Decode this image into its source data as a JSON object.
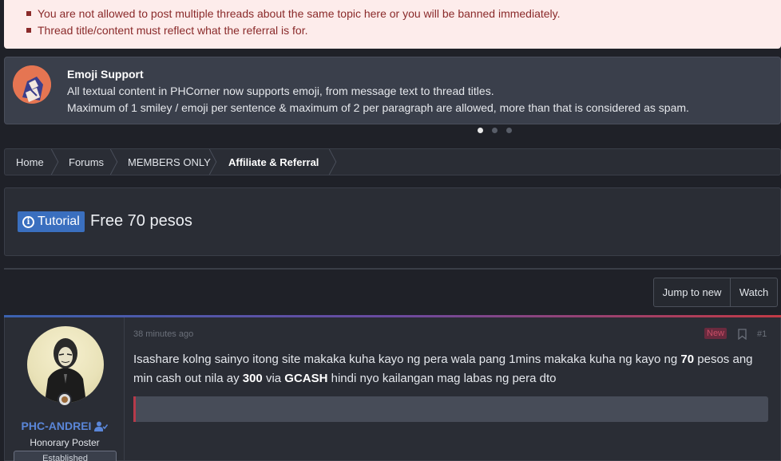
{
  "notices": {
    "rules": [
      "You are not allowed to post multiple threads about the same topic here or you will be banned immediately.",
      "Thread title/content must reflect what the referral is for."
    ],
    "emoji": {
      "title": "Emoji Support",
      "line1": "All textual content in PHCorner now supports emoji, from message text to thread titles.",
      "line2": "Maximum of 1 smiley / emoji per sentence & maximum of 2 per paragraph are allowed, more than that is considered as spam."
    },
    "carousel_active_index": 1,
    "carousel_count": 3
  },
  "breadcrumb": [
    "Home",
    "Forums",
    "MEMBERS ONLY",
    "Affiliate & Referral"
  ],
  "thread": {
    "prefix": "Tutorial",
    "title": "Free 70 pesos"
  },
  "actions": {
    "jump_to_new": "Jump to new",
    "watch": "Watch"
  },
  "post": {
    "time": "38 minutes ago",
    "new_label": "New",
    "number": "#1",
    "body_parts": {
      "p1": "Isashare kolng sainyo itong site makaka kuha kayo ng pera wala pang 1mins makaka kuha ng kayo ng ",
      "b1": "70",
      "p2": " pesos ang min cash out nila ay ",
      "b2": "300",
      "p3": " via ",
      "b3": "GCASH",
      "p4": " hindi nyo kailangan mag labas ng pera dto"
    },
    "user": {
      "name": "PHC-ANDREI",
      "title": "Honorary Poster",
      "banner": "Established"
    }
  },
  "colors": {
    "rules_bg": "#fdeceb",
    "rules_text": "#8a2a2a",
    "prefix_bg": "#3a6fbf",
    "username": "#5a86d8",
    "new_badge": "#6a2a3e"
  },
  "icons": {
    "prefix": "info-icon",
    "username": "verified-user-icon",
    "post_action": "bookmark-icon"
  }
}
